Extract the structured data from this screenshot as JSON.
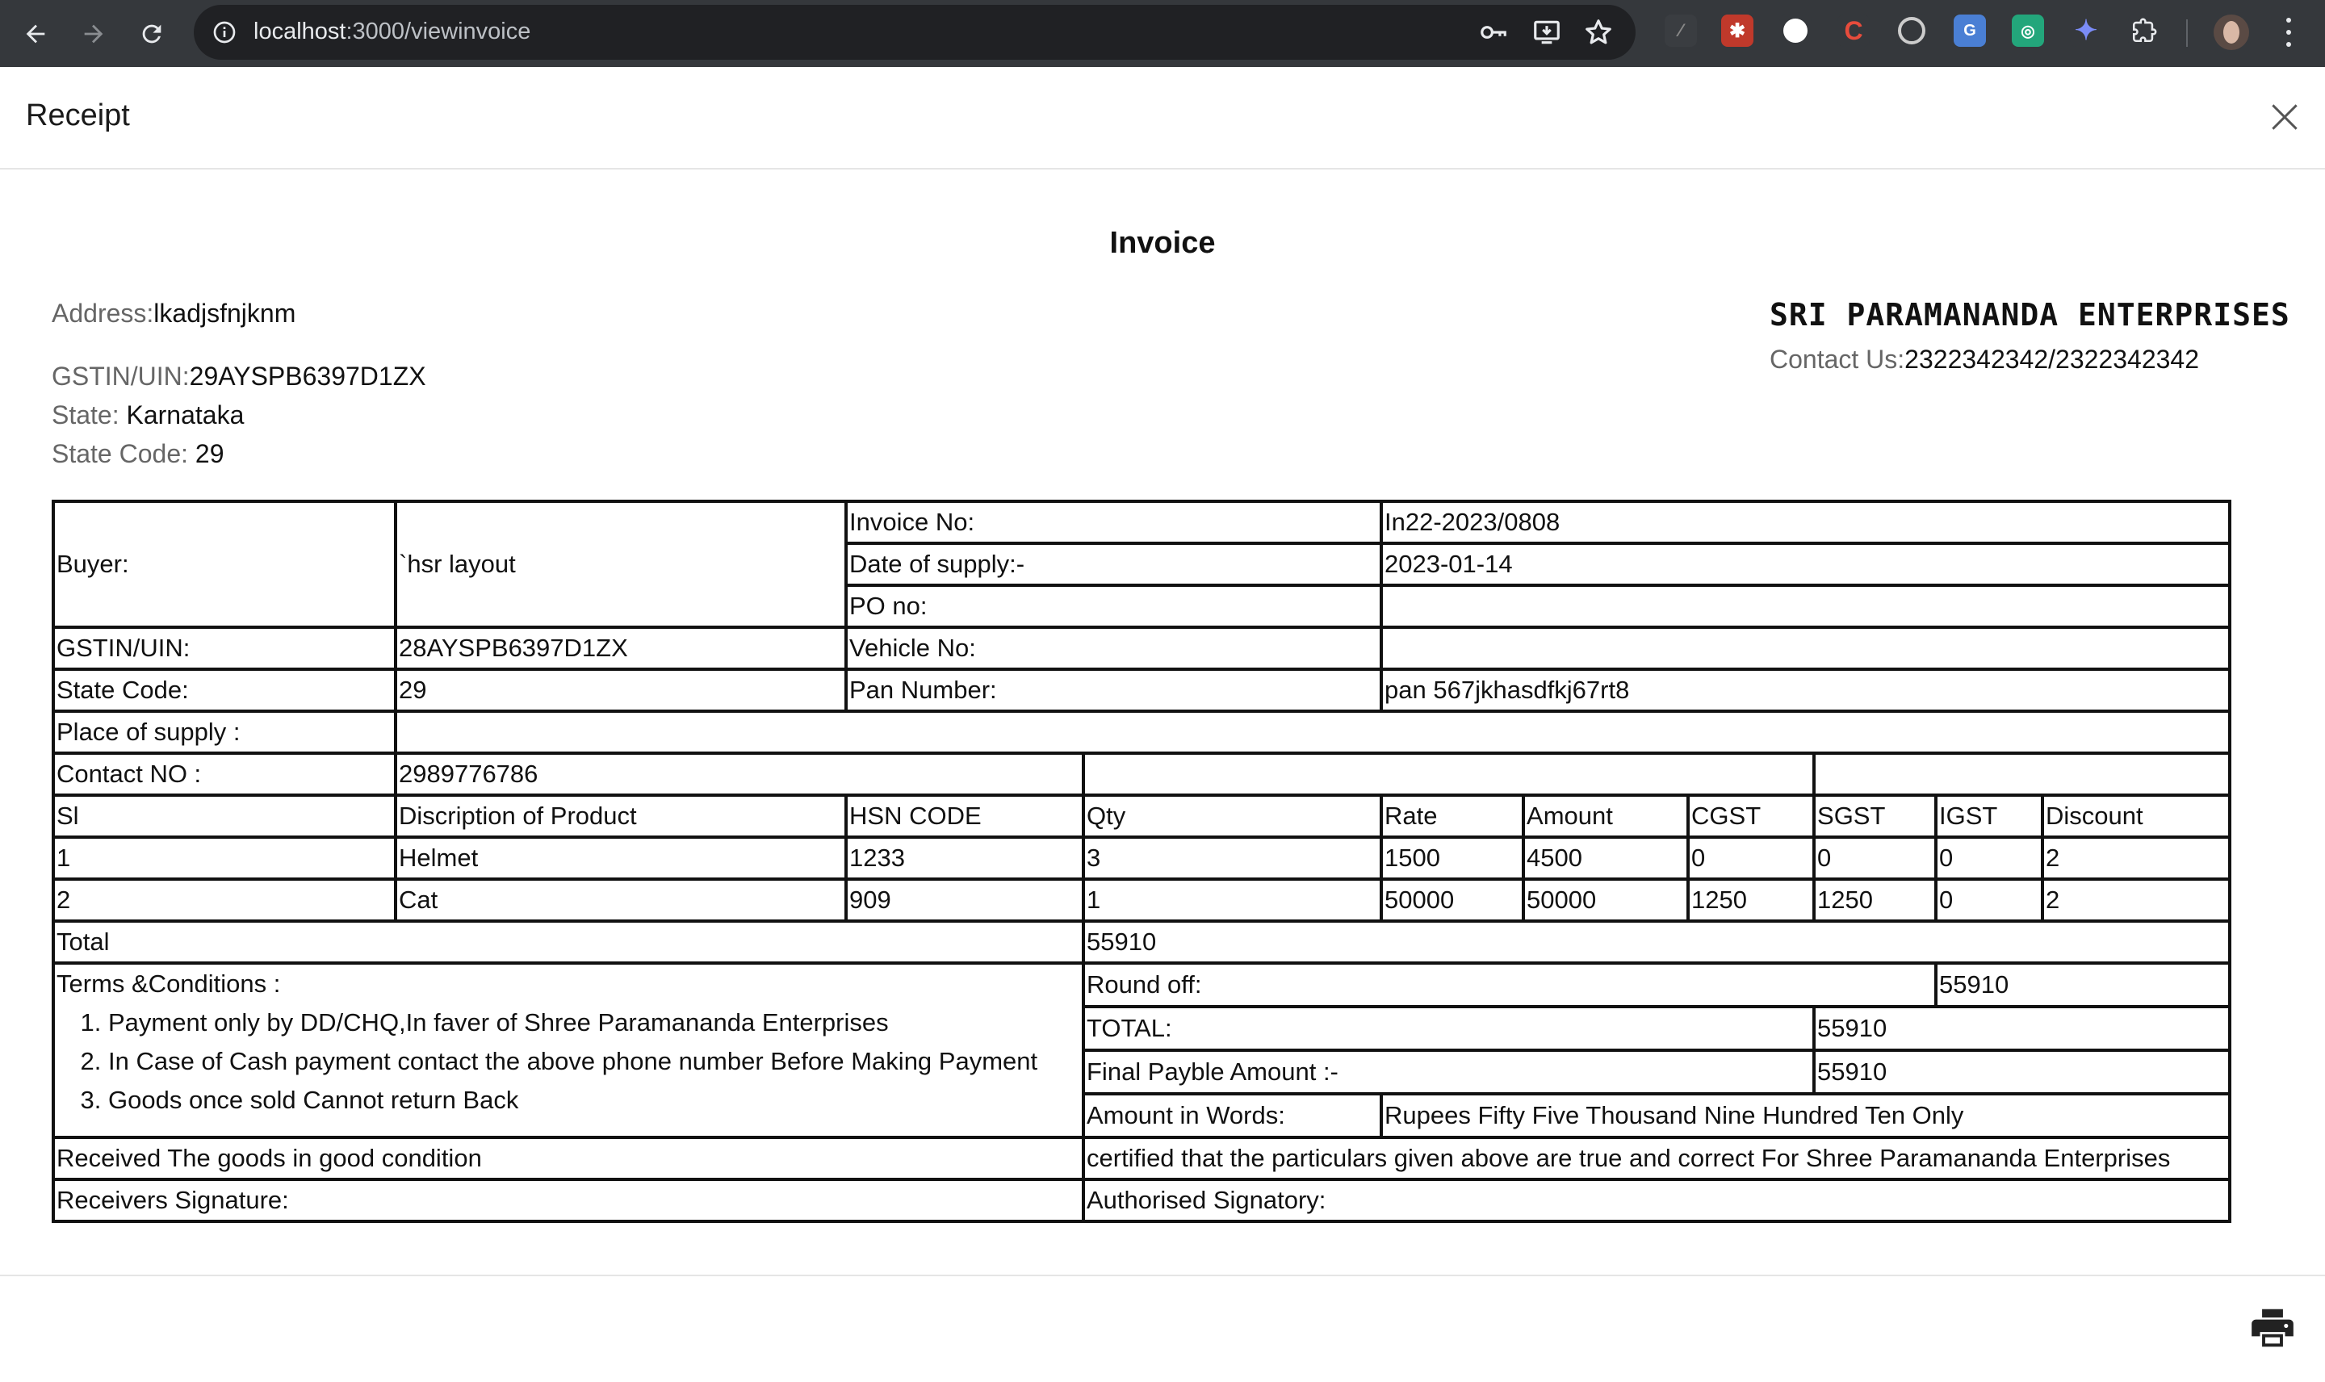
{
  "browser": {
    "url_host": "localhost",
    "url_path": ":3000/viewinvoice"
  },
  "modal": {
    "title": "Receipt"
  },
  "invoice": {
    "heading": "Invoice",
    "seller": {
      "address_label": "Address:",
      "address_value": "lkadjsfnjknm",
      "gstin_label": "GSTIN/UIN:",
      "gstin_value": "29AYSPB6397D1ZX",
      "state_label": "State: ",
      "state_value": "Karnataka",
      "state_code_label": "State Code: ",
      "state_code_value": "29"
    },
    "company": {
      "name": "SRI PARAMANANDA ENTERPRISES",
      "contact_label": "Contact Us:",
      "contact_value": "2322342342/2322342342"
    },
    "buyer": {
      "buyer_label": "Buyer:",
      "buyer_value": "`hsr layout",
      "gstin_label": "GSTIN/UIN:",
      "gstin_value": "28AYSPB6397D1ZX",
      "state_code_label": "State Code:",
      "state_code_value": "29",
      "place_label": "Place of supply :",
      "place_value": "",
      "contact_label": "Contact NO :",
      "contact_value": "2989776786"
    },
    "meta": {
      "invoice_no_label": "Invoice No:",
      "invoice_no_value": "In22-2023/0808",
      "date_label": "Date of supply:-",
      "date_value": "2023-01-14",
      "po_label": "PO no:",
      "po_value": "",
      "vehicle_label": "Vehicle No:",
      "vehicle_value": "",
      "pan_label": "Pan Number:",
      "pan_value": "pan 567jkhasdfkj67rt8"
    },
    "columns": [
      "Sl",
      "Discription of Product",
      "HSN CODE",
      "Qty",
      "Rate",
      "Amount",
      "CGST",
      "SGST",
      "IGST",
      "Discount"
    ],
    "items": [
      [
        "1",
        "Helmet",
        "1233",
        "3",
        "1500",
        "4500",
        "0",
        "0",
        "0",
        "2"
      ],
      [
        "2",
        "Cat",
        "909",
        "1",
        "50000",
        "50000",
        "1250",
        "1250",
        "0",
        "2"
      ]
    ],
    "total_label": "Total",
    "total_value": "55910",
    "terms_title": "Terms &Conditions :",
    "terms": [
      "Payment only by DD/CHQ,In faver of Shree Paramananda Enterprises",
      "In Case of Cash payment contact the above phone number Before Making Payment",
      "Goods once sold Cannot return Back"
    ],
    "round_off_label": "Round off:",
    "round_off_value": "55910",
    "grand_total_label": "TOTAL:",
    "grand_total_value": "55910",
    "final_label": "Final Payble Amount :-",
    "final_value": "55910",
    "words_label": "Amount in Words:",
    "words_value": "Rupees Fifty Five Thousand Nine Hundred Ten Only",
    "received_text": "Received The goods in good condition",
    "certified_text": "certified that the particulars given above are true and correct For Shree Paramananda Enterprises",
    "receiver_sig_label": "Receivers Signature:",
    "auth_sig_label": "Authorised Signatory:"
  },
  "icons": {
    "back": "arrow-left-icon",
    "forward": "arrow-right-icon",
    "reload": "reload-icon",
    "site_info": "info-icon",
    "password": "key-icon",
    "install": "install-icon",
    "bookmark": "star-icon",
    "close": "close-icon",
    "print": "printer-icon"
  }
}
